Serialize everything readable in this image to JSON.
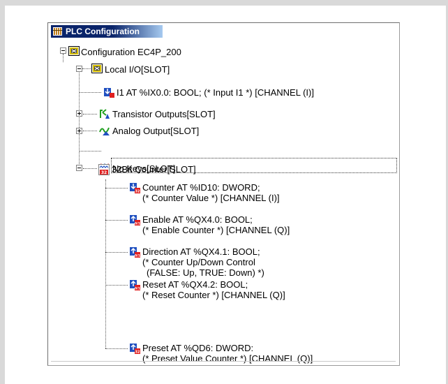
{
  "window": {
    "title": "PLC Configuration",
    "app_icon": "plc-config-icon"
  },
  "tree": {
    "root": {
      "label": "Configuration EC4P_200",
      "icon": "configuration-icon"
    },
    "local_io": {
      "label": "Local I/O[SLOT]",
      "icon": "slot-icon"
    },
    "input_i1": {
      "label": "I1 AT %IX0.0: BOOL; (* Input I1 *) [CHANNEL (I)]",
      "icon": "input-channel-icon"
    },
    "transistor_outputs": {
      "label": "Transistor Outputs[SLOT]",
      "icon": "transistor-output-icon"
    },
    "analog_output": {
      "label": "Analog Output[SLOT]",
      "icon": "analog-output-icon"
    },
    "no_keys": {
      "label": "No Keys[SLOT]",
      "icon": "no-keys-icon"
    },
    "counter_slot": {
      "label": "32Bit Counter[SLOT]",
      "icon": "counter-slot-icon"
    },
    "counter_children": [
      {
        "line1": "Counter AT %ID10: DWORD;",
        "line2": "(* Counter Value *) [CHANNEL (I)]",
        "icon": "input-dword-icon"
      },
      {
        "line1": "Enable AT %QX4.0: BOOL;",
        "line2": "(* Enable Counter *) [CHANNEL (Q)]",
        "icon": "output-bool-icon"
      },
      {
        "line1": "Direction AT %QX4.1: BOOL;",
        "line2": "(* Counter Up/Down Control",
        "line3": "(FALSE: Up, TRUE: Down) *)",
        "icon": "output-bool-icon"
      },
      {
        "line1": "Reset AT %QX4.2: BOOL;",
        "line2": "(* Reset Counter *) [CHANNEL (Q)]",
        "icon": "output-bool-icon"
      },
      {
        "line1": "Preset AT %QD6: DWORD:",
        "line2": "(* Preset Value Counter *) [CHANNEL (Q)]",
        "icon": "output-dword-icon"
      }
    ]
  }
}
